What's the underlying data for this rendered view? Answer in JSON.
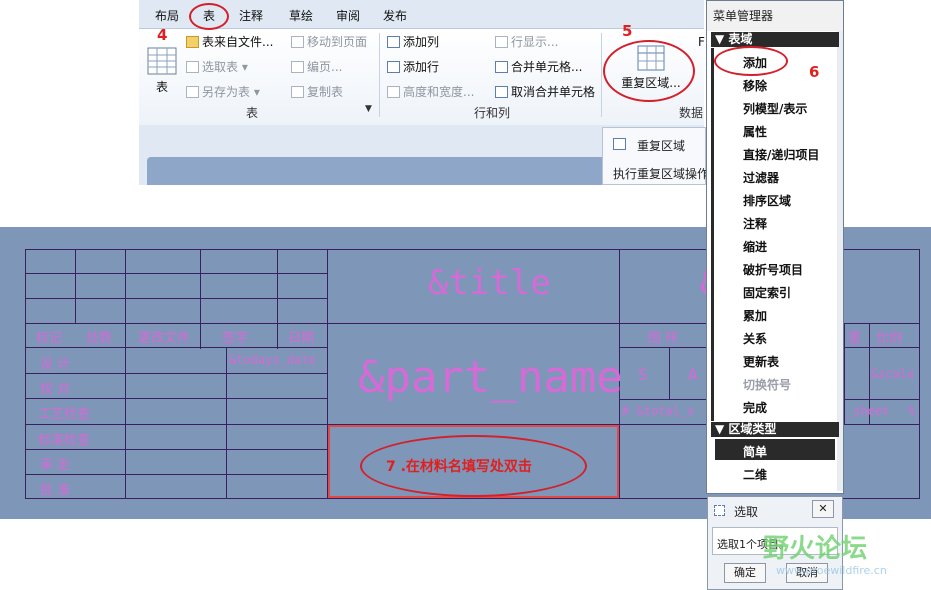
{
  "ribbon": {
    "tabs": [
      "布局",
      "表",
      "注释",
      "草绘",
      "审阅",
      "发布"
    ],
    "table_group": {
      "big_button": "表",
      "items": [
        "表来自文件...",
        "选取表",
        "另存为表"
      ],
      "disabled_items": [
        "移动到页面",
        "编页...",
        "复制表"
      ],
      "label": "表"
    },
    "rowcol_group": {
      "items": [
        "添加列",
        "添加行",
        "高度和宽度..."
      ],
      "items2": [
        "行显示...",
        "合并单元格...",
        "取消合并单元格"
      ],
      "label": "行和列"
    },
    "data_group": {
      "big_button": "重复区域...",
      "label": "数据",
      "overflow": "F"
    }
  },
  "tooltip": {
    "title": "重复区域",
    "desc": "执行重复区域操作"
  },
  "annotations": {
    "step4": "4",
    "step5": "5",
    "step6": "6",
    "step7": "7 .在材料名填写处双击"
  },
  "title_block": {
    "title_param": "&title",
    "part_name_param": "&part_name",
    "todays_date_param": "&todays_date",
    "scale_param": "&scale",
    "total_param": "# &total_s",
    "sheet_param": "_sheet",
    "title_partial": "&",
    "header_labels": [
      "标记",
      "处数",
      "更改文件",
      "签字",
      "日期"
    ],
    "left_labels": [
      "设 计",
      "校 对",
      "工艺检查",
      "标准检查",
      "审 定",
      "批 准"
    ],
    "right_labels": [
      "图 样",
      "重",
      "比例"
    ],
    "right_row2": [
      "S",
      "A"
    ],
    "right_row3_tail": "%"
  },
  "menu_manager": {
    "title": "菜单管理器",
    "section1": "表域",
    "items": [
      "添加",
      "移除",
      "列模型/表示",
      "属性",
      "直接/递归项目",
      "过滤器",
      "排序区域",
      "注释",
      "缩进",
      "破折号项目",
      "固定索引",
      "累加",
      "关系",
      "更新表",
      "切换符号",
      "完成"
    ],
    "section2": "区域类型",
    "type_items": [
      "简单",
      "二维"
    ]
  },
  "pick_dialog": {
    "title": "选取",
    "message": "选取1个项目。",
    "ok": "确定",
    "cancel": "取消",
    "close": "✕"
  },
  "watermark": {
    "logo_text": "野火论坛",
    "url": "www.proewildfire.cn"
  }
}
